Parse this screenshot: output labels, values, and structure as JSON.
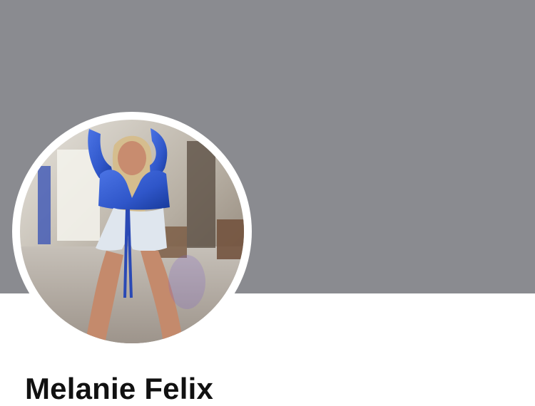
{
  "profile": {
    "name": "Melanie Felix"
  },
  "cover": {
    "color": "#8a8b90"
  },
  "avatar": {
    "icon": "profile-photo",
    "top_color": "#2f56c9",
    "shorts_color": "#dfe6ee"
  }
}
